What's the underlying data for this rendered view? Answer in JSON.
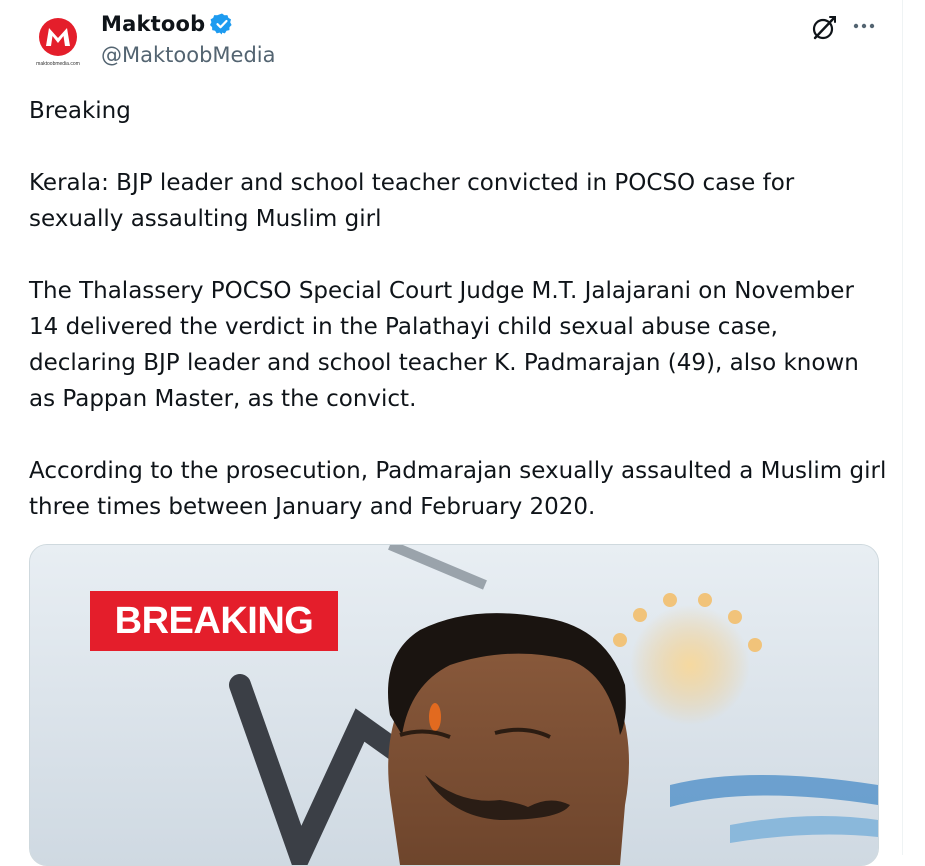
{
  "author": {
    "display_name": "Maktoob",
    "handle": "@MaktoobMedia",
    "verified": true,
    "avatar_text": "maktoobmedia.com",
    "brand_color": "#e41e2b"
  },
  "header_icons": {
    "grok": "grok-icon",
    "more": "more-icon"
  },
  "tweet": {
    "paragraphs": [
      "Breaking",
      "Kerala: BJP leader and school teacher convicted in POCSO case for sexually assaulting Muslim girl",
      "The Thalassery POCSO Special Court Judge M.T. Jalajarani on November 14 delivered the verdict in the Palathayi child sexual abuse case, declaring BJP leader and school teacher K. Padmarajan (49), also known as Pappan Master, as the convict.",
      "According to the prosecution, Padmarajan sexually assaulted a Muslim girl three times between January and February 2020."
    ]
  },
  "media": {
    "badge_text": "BREAKING",
    "badge_color": "#e41e2b"
  }
}
